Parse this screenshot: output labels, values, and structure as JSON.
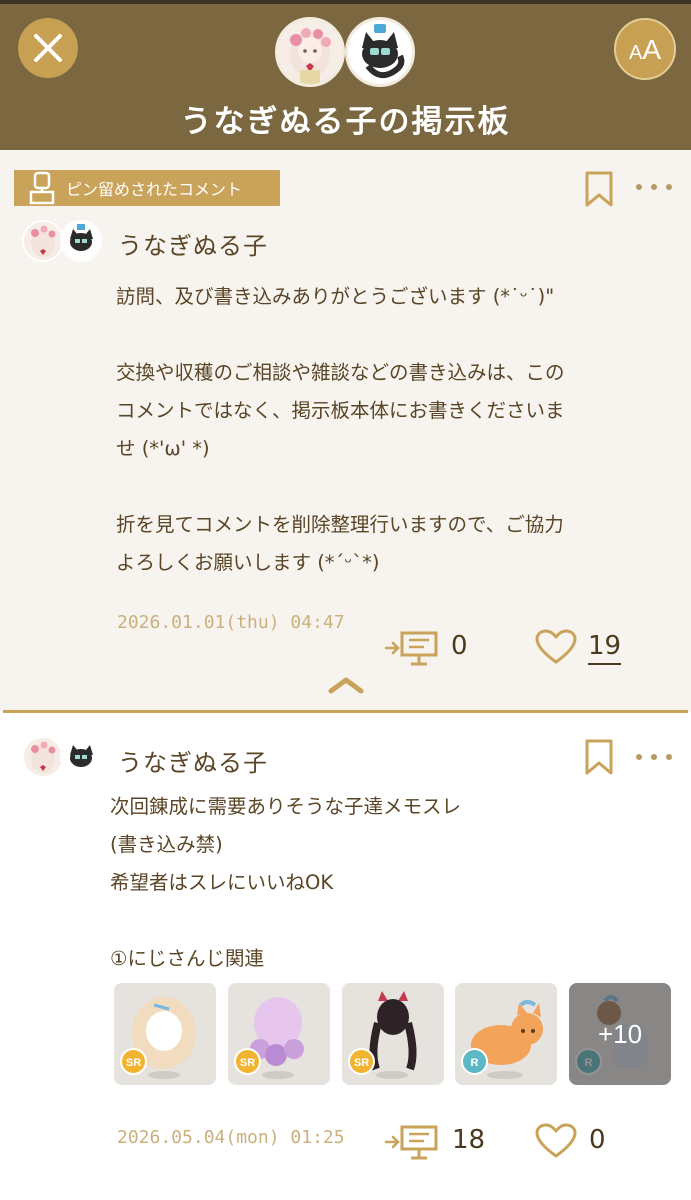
{
  "header": {
    "title": "うなぎぬる子の掲示板",
    "font_size_label_small": "A",
    "font_size_label_large": "A"
  },
  "pinned_post": {
    "badge": "ピン留めされたコメント",
    "author": "うなぎぬる子",
    "body": "訪問、及び書き込みありがとうございます (*˙ᵕ˙)\"\n\n交換や収穫のご相談や雑談などの書き込みは、この\nコメントではなく、掲示板本体にお書きくださいま\nせ (*'ω' *)\n\n折を見てコメントを削除整理行いますので、ご協力\nよろしくお願いします (*´ᵕ`*)",
    "timestamp": "2026.01.01(thu) 04:47",
    "reply_count": "0",
    "like_count": "19"
  },
  "thread_post": {
    "author": "うなぎぬる子",
    "body": "次回錬成に需要ありそうな子達メモスレ\n(書き込み禁)\n希望者はスレにいいねOK\n\n①にじさんじ関連",
    "thumbnails": [
      {
        "rarity": "SR",
        "rarity_color": "#f1b431"
      },
      {
        "rarity": "SR",
        "rarity_color": "#f1b431"
      },
      {
        "rarity": "SR",
        "rarity_color": "#f1b431"
      },
      {
        "rarity": "R",
        "rarity_color": "#5bb8c4"
      },
      {
        "rarity": "R",
        "rarity_color": "#5bb8c4",
        "more": "+10"
      }
    ],
    "timestamp": "2026.05.04(mon) 01:25",
    "reply_count": "18",
    "like_count": "0"
  },
  "colors": {
    "header_bg": "#7b6840",
    "accent_gold": "#c9a35a",
    "text_brown": "#5a4526",
    "timestamp": "#cbb07e",
    "pinned_bg": "#f7f4ef"
  },
  "icons": [
    "close-icon",
    "font-size-icon",
    "pin-icon",
    "bookmark-icon",
    "more-icon",
    "reply-icon",
    "heart-icon",
    "chevron-up-icon"
  ]
}
